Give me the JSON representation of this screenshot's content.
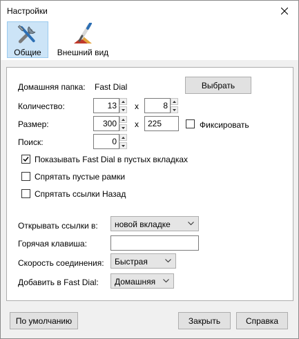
{
  "window": {
    "title": "Настройки"
  },
  "toolbar": {
    "tabs": [
      {
        "label": "Общие",
        "icon": "tools-icon"
      },
      {
        "label": "Внешний вид",
        "icon": "paintbrush-icon"
      }
    ]
  },
  "general": {
    "home_folder_label": "Домашняя папка:",
    "home_folder_value": "Fast Dial",
    "choose_button": "Выбрать",
    "count_label": "Количество:",
    "count_cols": "13",
    "count_rows": "8",
    "times_sign": "x",
    "size_label": "Размер:",
    "size_width": "300",
    "size_height": "225",
    "fix_label": "Фиксировать",
    "search_label": "Поиск:",
    "search_value": "0",
    "show_fast_dial_label": "Показывать Fast Dial в пустых вкладках",
    "show_fast_dial_checked": true,
    "hide_empty_frames_label": "Спрятать пустые рамки",
    "hide_empty_frames_checked": false,
    "hide_back_links_label": "Спрятать ссылки Назад",
    "hide_back_links_checked": false,
    "open_links_label": "Открывать ссылки в:",
    "open_links_value": "новой вкладке",
    "hotkey_label": "Горячая клавиша:",
    "hotkey_value": "",
    "speed_label": "Скорость соединения:",
    "speed_value": "Быстрая",
    "add_to_label": "Добавить в Fast Dial:",
    "add_to_value": "Домашняя"
  },
  "footer": {
    "defaults_button": "По умолчанию",
    "close_button": "Закрыть",
    "help_button": "Справка"
  }
}
